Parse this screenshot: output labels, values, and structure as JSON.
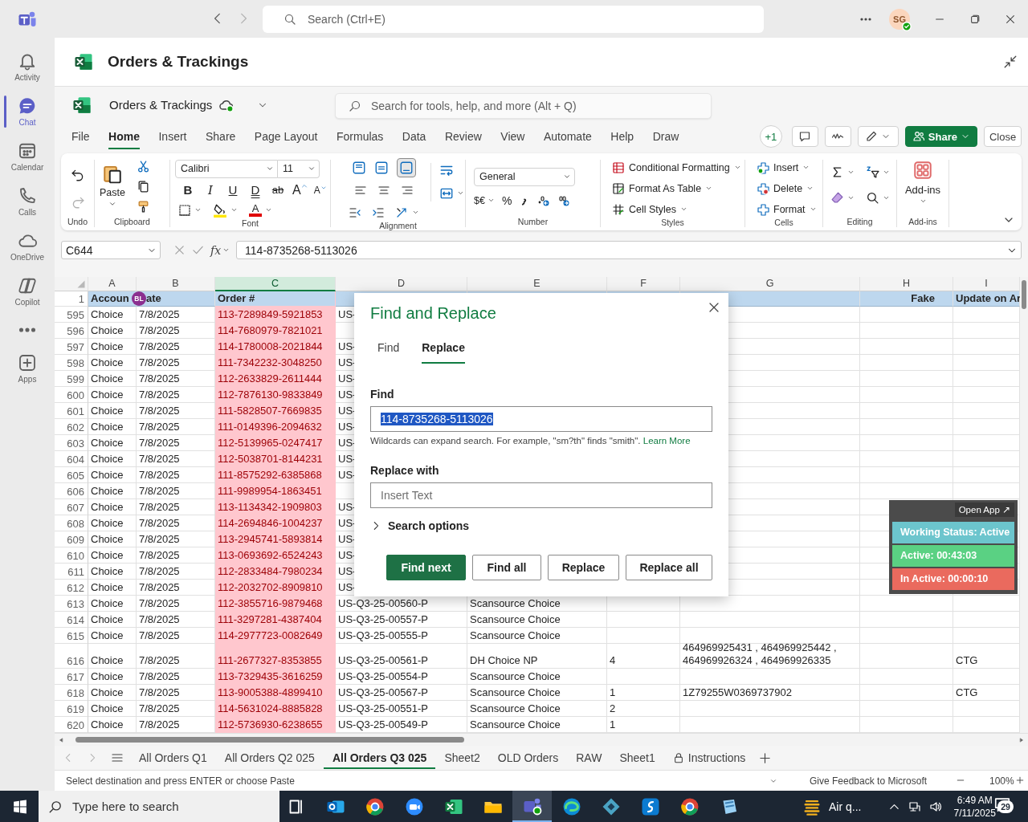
{
  "teams": {
    "search_placeholder": "Search (Ctrl+E)",
    "avatar": "SG"
  },
  "rail": [
    {
      "label": "Activity",
      "kind": "bell",
      "selected": false
    },
    {
      "label": "Chat",
      "kind": "chat",
      "selected": true
    },
    {
      "label": "Calendar",
      "kind": "calendar",
      "selected": false
    },
    {
      "label": "Calls",
      "kind": "phone",
      "selected": false
    },
    {
      "label": "OneDrive",
      "kind": "cloud",
      "selected": false
    },
    {
      "label": "Copilot",
      "kind": "copilot",
      "selected": false
    },
    {
      "kind": "more",
      "selected": false
    },
    {
      "label": "Apps",
      "kind": "apps",
      "selected": false
    }
  ],
  "document_title": "Orders & Trackings",
  "file_name": "Orders & Trackings",
  "tool_search_placeholder": "Search for tools, help, and more (Alt + Q)",
  "menu_tabs": [
    {
      "label": "File",
      "selected": false
    },
    {
      "label": "Home",
      "selected": true
    },
    {
      "label": "Insert",
      "selected": false
    },
    {
      "label": "Share",
      "selected": false
    },
    {
      "label": "Page Layout",
      "selected": false
    },
    {
      "label": "Formulas",
      "selected": false
    },
    {
      "label": "Data",
      "selected": false
    },
    {
      "label": "Review",
      "selected": false
    },
    {
      "label": "View",
      "selected": false
    },
    {
      "label": "Automate",
      "selected": false
    },
    {
      "label": "Help",
      "selected": false
    },
    {
      "label": "Draw",
      "selected": false
    }
  ],
  "toolbar": {
    "presence": "+1",
    "share": "Share",
    "close": "Close"
  },
  "ribbon": {
    "paste": "Paste",
    "font_name": "Calibri",
    "font_size": "11",
    "font_buttons": [
      {
        "label": "B",
        "kind": "bold"
      },
      {
        "label": "I",
        "kind": "italic"
      },
      {
        "label": "U",
        "kind": "underline"
      },
      {
        "label": "D",
        "kind": "double-underline"
      },
      {
        "label": "ab",
        "kind": "strikethrough"
      },
      {
        "label": "A",
        "kind": "grow"
      },
      {
        "label": "A",
        "kind": "shrink"
      }
    ],
    "font_color_label": "A",
    "number_format": "General",
    "currency": "$€",
    "percent": "%",
    "styles": [
      "Conditional Formatting",
      "Format As Table",
      "Cell Styles"
    ],
    "cells": [
      "Insert",
      "Delete",
      "Format"
    ],
    "addins": "Add-ins",
    "groups": [
      "Undo",
      "Clipboard",
      "Font",
      "Alignment",
      "Number",
      "Styles",
      "Cells",
      "Editing",
      "Add-ins"
    ]
  },
  "formula_bar": {
    "name_box": "C644",
    "function_label": "fx",
    "formula": "114-8735268-5113026"
  },
  "grid": {
    "columns": [
      {
        "letter": "A",
        "selected": false,
        "highlighted": false
      },
      {
        "letter": "B",
        "selected": false,
        "highlighted": false
      },
      {
        "letter": "C",
        "selected": true,
        "highlighted": true
      },
      {
        "letter": "D",
        "selected": false,
        "highlighted": false
      },
      {
        "letter": "E",
        "selected": false,
        "highlighted": false
      },
      {
        "letter": "F",
        "selected": false,
        "highlighted": false
      },
      {
        "letter": "G",
        "selected": false,
        "highlighted": false
      },
      {
        "letter": "H",
        "selected": false,
        "highlighted": false
      },
      {
        "letter": "I",
        "selected": false,
        "highlighted": false
      }
    ],
    "collaborator": "BL",
    "header_row": {
      "number": "1",
      "cells": [
        "Accoun",
        "ate",
        "Order #",
        null,
        null,
        null,
        null,
        "Fake",
        "Update on Ar"
      ]
    },
    "rows": [
      {
        "number": "595",
        "cells": [
          "Choice",
          "7/8/2025",
          "113-7289849-5921853",
          "US-",
          null,
          null,
          null,
          null,
          null
        ]
      },
      {
        "number": "596",
        "cells": [
          "Choice",
          "7/8/2025",
          "114-7680979-7821021",
          null,
          null,
          null,
          null,
          null,
          null
        ]
      },
      {
        "number": "597",
        "cells": [
          "Choice",
          "7/8/2025",
          "114-1780008-2021844",
          "US-",
          null,
          null,
          null,
          null,
          null
        ]
      },
      {
        "number": "598",
        "cells": [
          "Choice",
          "7/8/2025",
          "111-7342232-3048250",
          "US-",
          null,
          null,
          null,
          null,
          null
        ]
      },
      {
        "number": "599",
        "cells": [
          "Choice",
          "7/8/2025",
          "112-2633829-2611444",
          "US-",
          null,
          null,
          null,
          null,
          null
        ]
      },
      {
        "number": "600",
        "cells": [
          "Choice",
          "7/8/2025",
          "112-7876130-9833849",
          "US-",
          null,
          null,
          null,
          null,
          null
        ]
      },
      {
        "number": "601",
        "cells": [
          "Choice",
          "7/8/2025",
          "111-5828507-7669835",
          "US-",
          null,
          null,
          null,
          null,
          null
        ]
      },
      {
        "number": "602",
        "cells": [
          "Choice",
          "7/8/2025",
          "111-0149396-2094632",
          "US-",
          null,
          null,
          null,
          null,
          null
        ]
      },
      {
        "number": "603",
        "cells": [
          "Choice",
          "7/8/2025",
          "112-5139965-0247417",
          "US-",
          null,
          null,
          null,
          null,
          null
        ]
      },
      {
        "number": "604",
        "cells": [
          "Choice",
          "7/8/2025",
          "112-5038701-8144231",
          "US-",
          null,
          null,
          null,
          null,
          null
        ]
      },
      {
        "number": "605",
        "cells": [
          "Choice",
          "7/8/2025",
          "111-8575292-6385868",
          "US-",
          null,
          null,
          null,
          null,
          null
        ]
      },
      {
        "number": "606",
        "cells": [
          "Choice",
          "7/8/2025",
          "111-9989954-1863451",
          null,
          null,
          null,
          null,
          null,
          null
        ]
      },
      {
        "number": "607",
        "cells": [
          "Choice",
          "7/8/2025",
          "113-1134342-1909803",
          "US-",
          null,
          null,
          null,
          null,
          null
        ]
      },
      {
        "number": "608",
        "cells": [
          "Choice",
          "7/8/2025",
          "114-2694846-1004237",
          "US-",
          null,
          null,
          null,
          null,
          null
        ]
      },
      {
        "number": "609",
        "cells": [
          "Choice",
          "7/8/2025",
          "113-2945741-5893814",
          "US-",
          null,
          null,
          null,
          null,
          null
        ]
      },
      {
        "number": "610",
        "cells": [
          "Choice",
          "7/8/2025",
          "113-0693692-6524243",
          "US-",
          null,
          null,
          null,
          null,
          null
        ]
      },
      {
        "number": "611",
        "cells": [
          "Choice",
          "7/8/2025",
          "112-2833484-7980234",
          "US-",
          null,
          null,
          null,
          null,
          null
        ]
      },
      {
        "number": "612",
        "cells": [
          "Choice",
          "7/8/2025",
          "112-2032702-8909810",
          "US-",
          null,
          null,
          null,
          null,
          null
        ]
      },
      {
        "number": "613",
        "cells": [
          "Choice",
          "7/8/2025",
          "112-3855716-9879468",
          "US-Q3-25-00560-P",
          "Scansource Choice",
          null,
          null,
          null,
          null
        ]
      },
      {
        "number": "614",
        "cells": [
          "Choice",
          "7/8/2025",
          "111-3297281-4387404",
          "US-Q3-25-00557-P",
          "Scansource Choice",
          null,
          null,
          null,
          null
        ]
      },
      {
        "number": "615",
        "cells": [
          "Choice",
          "7/8/2025",
          "114-2977723-0082649",
          "US-Q3-25-00555-P",
          "Scansource Choice",
          null,
          null,
          null,
          null
        ]
      },
      {
        "number": "616",
        "cells": [
          "Choice",
          "7/8/2025",
          "111-2677327-8353855",
          "US-Q3-25-00561-P",
          "DH Choice NP",
          "4",
          "464969925431 , 464969925442 ,\n464969926324 , 464969926335",
          null,
          "CTG"
        ]
      },
      {
        "number": "617",
        "cells": [
          "Choice",
          "7/8/2025",
          "113-7329435-3616259",
          "US-Q3-25-00554-P",
          "Scansource Choice",
          null,
          null,
          null,
          null
        ]
      },
      {
        "number": "618",
        "cells": [
          "Choice",
          "7/8/2025",
          "113-9005388-4899410",
          "US-Q3-25-00567-P",
          "Scansource Choice",
          "1",
          "1Z79255W0369737902",
          null,
          "CTG"
        ]
      },
      {
        "number": "619",
        "cells": [
          "Choice",
          "7/8/2025",
          "114-5631024-8885828",
          "US-Q3-25-00551-P",
          "Scansource Choice",
          "2",
          null,
          null,
          null
        ]
      },
      {
        "number": "620",
        "cells": [
          "Choice",
          "7/8/2025",
          "112-5736930-6238655",
          "US-Q3-25-00549-P",
          "Scansource Choice",
          "1",
          null,
          null,
          null
        ]
      }
    ]
  },
  "dialog": {
    "title": "Find and Replace",
    "tabs": [
      {
        "label": "Find",
        "selected": false
      },
      {
        "label": "Replace",
        "selected": true
      }
    ],
    "find_label": "Find",
    "find_value": "114-8735268-5113026",
    "find_value_selected": true,
    "hint": "Wildcards can expand search. For example, \"sm?th\" finds \"smith\".",
    "hint_link": "Learn More",
    "replace_label": "Replace with",
    "replace_placeholder": "Insert Text",
    "options": {
      "label": "Search options",
      "expanded": false
    },
    "buttons": [
      {
        "label": "Find next",
        "primary": true
      },
      {
        "label": "Find all",
        "primary": false
      },
      {
        "label": "Replace",
        "primary": false
      },
      {
        "label": "Replace all",
        "primary": false
      }
    ]
  },
  "tracker": {
    "open_app": "Open App ↗",
    "items": [
      {
        "label": "Working Status: Active",
        "color": "#6cc5cd"
      },
      {
        "label": "Active: 00:43:03",
        "color": "#5ad183"
      },
      {
        "label": "In Active: 00:00:10",
        "color": "#ea6a5e"
      }
    ]
  },
  "sheet_tabs": [
    {
      "label": "All Orders Q1",
      "selected": false,
      "locked": false
    },
    {
      "label": "All Orders Q2 025",
      "selected": false,
      "locked": false
    },
    {
      "label": "All Orders Q3 025",
      "selected": true,
      "locked": false
    },
    {
      "label": "Sheet2",
      "selected": false,
      "locked": false
    },
    {
      "label": "OLD Orders",
      "selected": false,
      "locked": false
    },
    {
      "label": "RAW",
      "selected": false,
      "locked": false
    },
    {
      "label": "Sheet1",
      "selected": false,
      "locked": false
    },
    {
      "label": "Instructions",
      "selected": false,
      "locked": true
    }
  ],
  "status": {
    "message": "Select destination and press ENTER or choose Paste",
    "feedback": "Give Feedback to Microsoft",
    "zoom": "100%"
  },
  "taskbar": {
    "search_placeholder": "Type here to search",
    "apps": [
      {
        "kind": "task-view",
        "selected": false
      },
      {
        "kind": "mail",
        "selected": false
      },
      {
        "kind": "browser",
        "selected": false
      },
      {
        "kind": "video",
        "selected": false
      },
      {
        "kind": "spreadsheet",
        "selected": false
      },
      {
        "kind": "folder",
        "selected": false
      },
      {
        "kind": "chat",
        "selected": true
      },
      {
        "kind": "web",
        "selected": false
      },
      {
        "kind": "diamond",
        "selected": false
      },
      {
        "kind": "script",
        "selected": false
      },
      {
        "kind": "browser",
        "selected": false
      },
      {
        "kind": "notebook",
        "selected": false
      }
    ],
    "weather": "Air q...",
    "time": "6:49 AM",
    "date": "7/11/2025",
    "notifications": "29"
  }
}
